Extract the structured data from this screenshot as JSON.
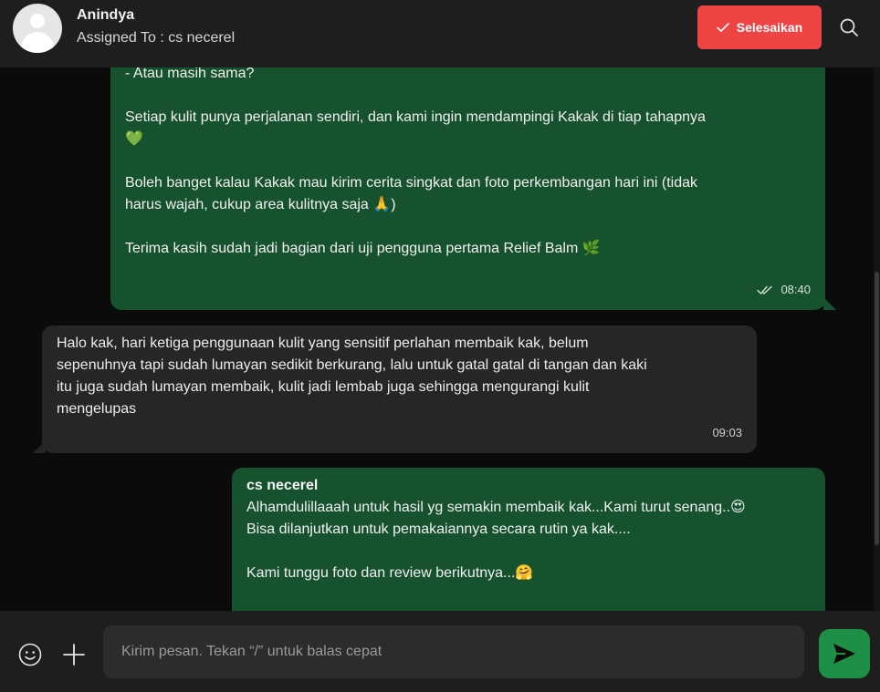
{
  "header": {
    "contact_name": "Anindya",
    "assigned_to": "Assigned To : cs necerel",
    "resolve_label": "Selesaikan",
    "resolve_color": "#ee4444"
  },
  "messages": [
    {
      "direction": "outgoing",
      "text": "- Atau masih sama?\n\nSetiap kulit punya perjalanan sendiri, dan kami ingin mendampingi Kakak di tiap tahapnya\n💚\n\nBoleh banget kalau Kakak mau kirim cerita singkat dan foto perkembangan hari ini (tidak\nharus wajah, cukup area kulitnya saja 🙏)\n\nTerima kasih sudah jadi bagian dari uji pengguna pertama Relief Balm 🌿",
      "time": "08:40",
      "status": "read"
    },
    {
      "direction": "incoming",
      "text": "Halo kak, hari ketiga penggunaan kulit yang sensitif perlahan membaik kak, belum\nsepenuhnya tapi sudah lumayan sedikit berkurang, lalu untuk gatal gatal di tangan dan kaki\nitu juga sudah lumayan membaik, kulit jadi lembab juga sehingga mengurangi kulit\nmengelupas",
      "time": "09:03"
    },
    {
      "direction": "outgoing",
      "sender": "cs necerel",
      "text": "Alhamdulillaaah untuk hasil yg semakin membaik kak...Kami turut senang..😍\nBisa dilanjutkan untuk pemakaiannya secara rutin ya kak....\n\nKami tunggu foto dan review berikutnya...🤗"
    }
  ],
  "composer": {
    "placeholder": "Kirim pesan. Tekan “/” untuk balas cepat"
  },
  "colors": {
    "outgoing_bubble": "#17522e",
    "incoming_bubble": "#262626",
    "send_button": "#1e8f47"
  },
  "icons": {
    "search": "search-icon",
    "check": "check-icon",
    "read_status": "double-check-icon",
    "emoji": "emoji-icon",
    "attach": "plus-icon",
    "send": "send-icon"
  }
}
